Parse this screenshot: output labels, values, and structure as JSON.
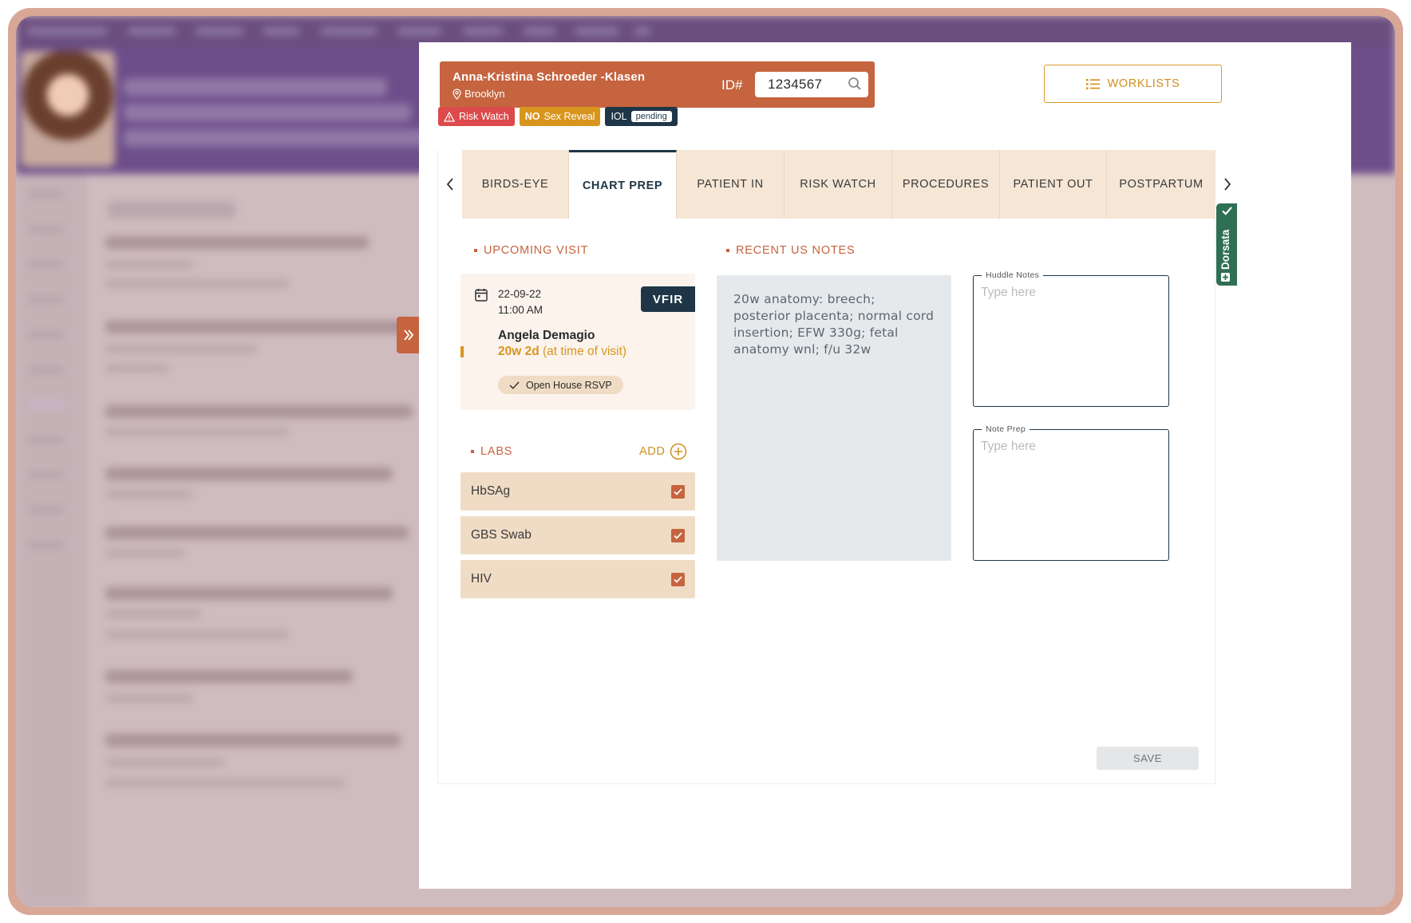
{
  "patient": {
    "name": "Anna-Kristina Schroeder -Klasen",
    "location": "Brooklyn",
    "id_label": "ID#",
    "id_value": "1234567"
  },
  "tags": {
    "risk_watch": "Risk Watch",
    "no_sex_reveal_bold": "NO",
    "no_sex_reveal_text": "Sex Reveal",
    "iol": "IOL",
    "iol_status": "pending"
  },
  "worklists_label": "WORKLISTS",
  "tabs": [
    {
      "label": "BIRDS-EYE",
      "active": false
    },
    {
      "label": "CHART PREP",
      "active": true
    },
    {
      "label": "PATIENT IN",
      "active": false
    },
    {
      "label": "RISK WATCH",
      "active": false
    },
    {
      "label": "PROCEDURES",
      "active": false
    },
    {
      "label": "PATIENT OUT",
      "active": false
    },
    {
      "label": "POSTPARTUM",
      "active": false
    }
  ],
  "upcoming_visit": {
    "section_label": "UPCOMING VISIT",
    "date": "22-09-22",
    "time": "11:00 AM",
    "visit_type": "VFIR",
    "provider": "Angela Demagio",
    "gestational_age_bold": "20w 2d",
    "gestational_age_note": "(at time of visit)",
    "rsvp_label": "Open House RSVP"
  },
  "labs": {
    "section_label": "LABS",
    "add_label": "ADD",
    "items": [
      {
        "name": "HbSAg",
        "checked": true
      },
      {
        "name": "GBS Swab",
        "checked": true
      },
      {
        "name": "HIV",
        "checked": true
      }
    ]
  },
  "recent_us_notes": {
    "section_label": "RECENT US NOTES",
    "text": "20w anatomy: breech; posterior placenta; normal cord insertion; EFW 330g; fetal anatomy wnl; f/u 32w"
  },
  "huddle_notes": {
    "label": "Huddle Notes",
    "placeholder": "Type here"
  },
  "note_prep": {
    "label": "Note Prep",
    "placeholder": "Type here"
  },
  "save_label": "SAVE",
  "dorsata_label": "Dorsata",
  "colors": {
    "brand_terracotta": "#c5643f",
    "navy": "#1e3647",
    "gold": "#d8951e",
    "tab_bg": "#f5e6d5",
    "dorsata_green": "#2f6f54",
    "risk_red": "#dc4a4b"
  }
}
